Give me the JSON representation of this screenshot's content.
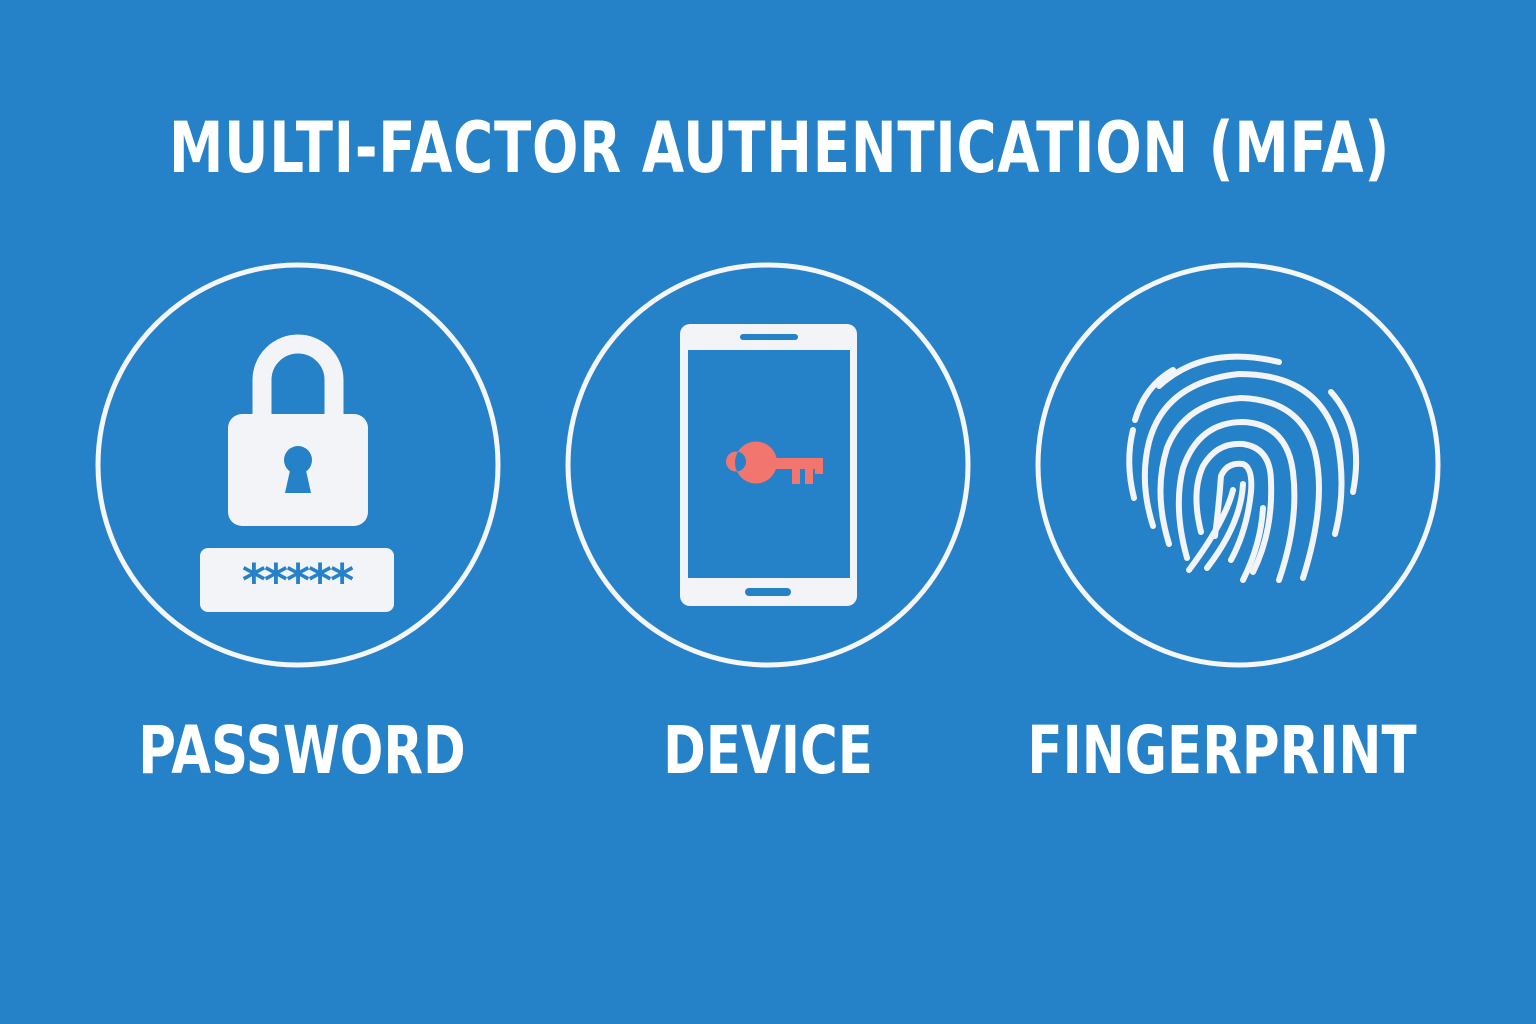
{
  "title": "MULTI-FACTOR AUTHENTICATION (MFA)",
  "factors": [
    {
      "label": "PASSWORD",
      "icon": "padlock-icon",
      "mask": "*****"
    },
    {
      "label": "DEVICE",
      "icon": "smartphone-key-icon"
    },
    {
      "label": "FINGERPRINT",
      "icon": "fingerprint-icon"
    }
  ],
  "colors": {
    "background": "#2581c8",
    "foreground": "#ffffff",
    "icon_fill": "#f2f4f7",
    "key_accent": "#f2766e"
  }
}
